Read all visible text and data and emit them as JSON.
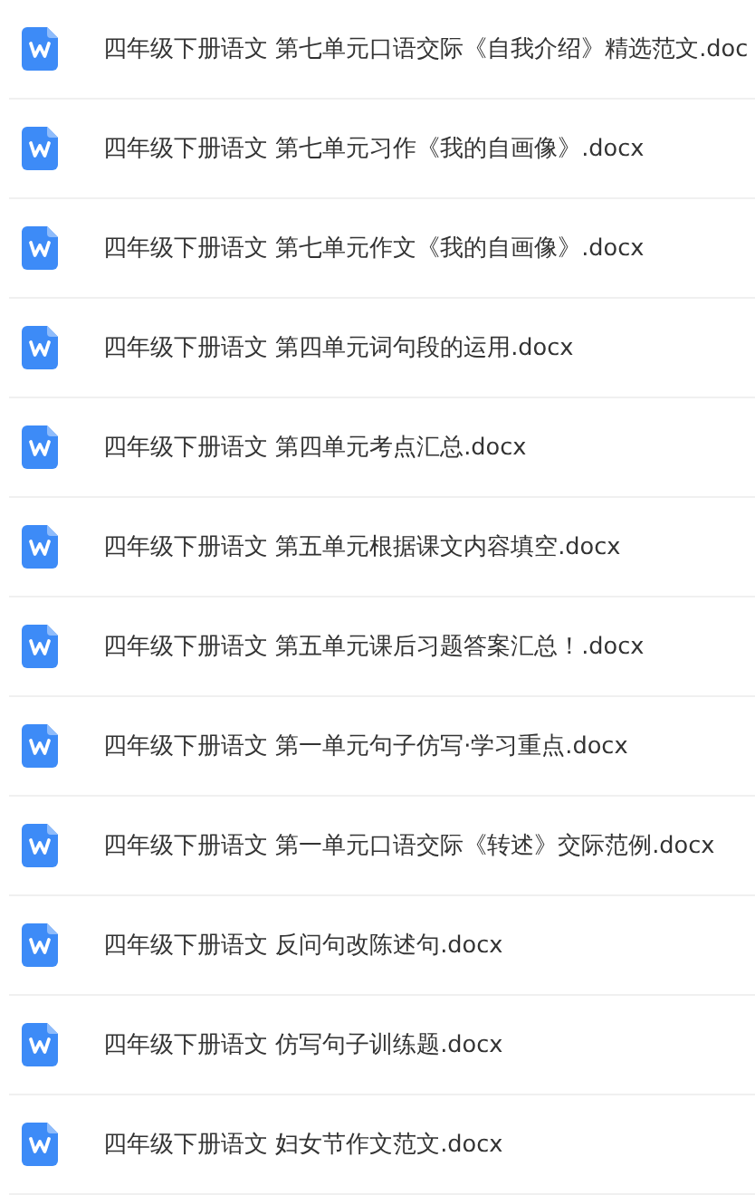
{
  "files": [
    {
      "name": "四年级下册语文 第七单元口语交际《自我介绍》精选范文.doc"
    },
    {
      "name": "四年级下册语文 第七单元习作《我的自画像》.docx"
    },
    {
      "name": "四年级下册语文 第七单元作文《我的自画像》.docx"
    },
    {
      "name": "四年级下册语文 第四单元词句段的运用.docx"
    },
    {
      "name": "四年级下册语文 第四单元考点汇总.docx"
    },
    {
      "name": "四年级下册语文 第五单元根据课文内容填空.docx"
    },
    {
      "name": "四年级下册语文 第五单元课后习题答案汇总！.docx"
    },
    {
      "name": "四年级下册语文 第一单元句子仿写·学习重点.docx"
    },
    {
      "name": "四年级下册语文 第一单元口语交际《转述》交际范例.docx"
    },
    {
      "name": "四年级下册语文 反问句改陈述句.docx"
    },
    {
      "name": "四年级下册语文 仿写句子训练题.docx"
    },
    {
      "name": "四年级下册语文 妇女节作文范文.docx"
    }
  ]
}
